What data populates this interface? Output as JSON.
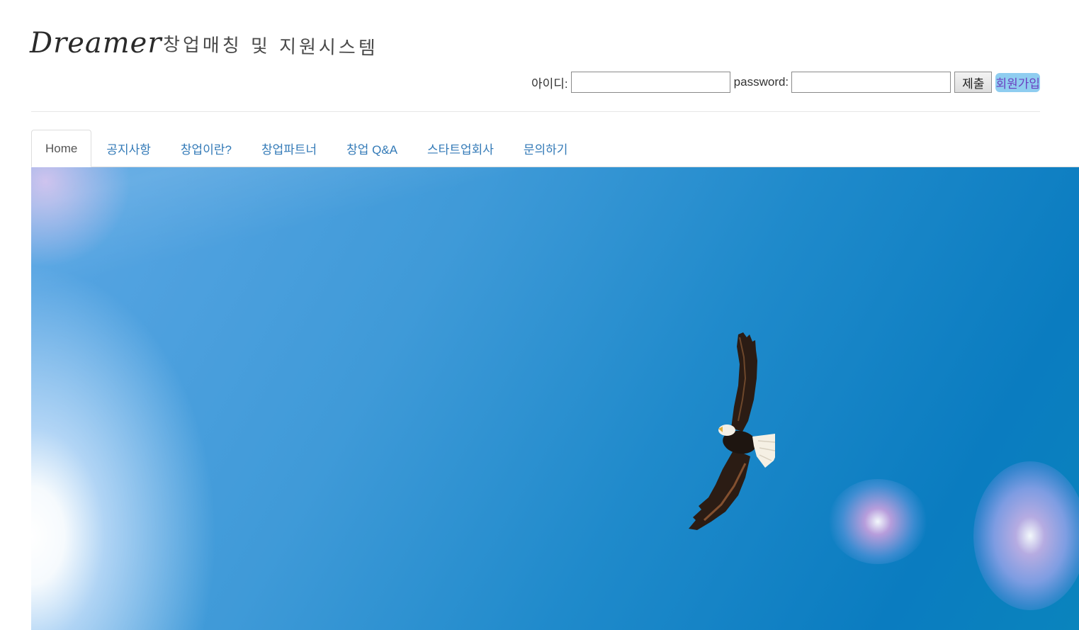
{
  "header": {
    "brand_name": "Dreamer",
    "brand_tagline": "창업매칭 및 지원시스템"
  },
  "login": {
    "id_label": "아이디:",
    "id_value": "",
    "password_label": "password:",
    "password_value": "",
    "submit_label": "제출",
    "join_label": "회원가입"
  },
  "nav": {
    "tabs": [
      {
        "label": "Home",
        "active": true
      },
      {
        "label": "공지사항",
        "active": false
      },
      {
        "label": "창업이란?",
        "active": false
      },
      {
        "label": "창업파트너",
        "active": false
      },
      {
        "label": "창업 Q&A",
        "active": false
      },
      {
        "label": "스타트업회사",
        "active": false
      },
      {
        "label": "문의하기",
        "active": false
      }
    ]
  },
  "hero": {
    "image": "eagle-soaring-blue-sky"
  },
  "colors": {
    "link": "#337ab7",
    "active_tab_text": "#555555",
    "join_highlight": "#8fcdf0",
    "sky": "#1f8acb"
  }
}
